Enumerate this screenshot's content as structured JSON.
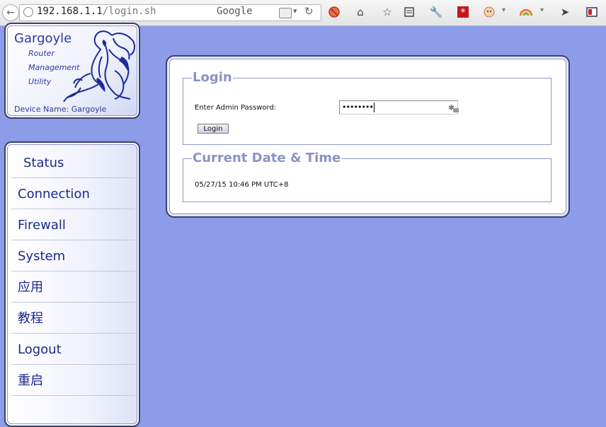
{
  "browser": {
    "url_host": "192.168.1.1",
    "url_path": "/login.sh",
    "search_engine": "Google",
    "toolbar_icons": [
      "adblock-icon",
      "home-icon",
      "bookmark-star-icon",
      "reader-icon",
      "wrench-icon",
      "addon-asterisk-icon",
      "face-addon-icon",
      "rainbow-addon-icon",
      "share-icon",
      "window-flag-icon"
    ]
  },
  "logo": {
    "title": "Gargoyle",
    "sub1": "Router",
    "sub2": "Management",
    "sub3": "Utility",
    "device_name": "Device Name: Gargoyle"
  },
  "nav": {
    "items": [
      {
        "label": "Status"
      },
      {
        "label": "Connection"
      },
      {
        "label": "Firewall"
      },
      {
        "label": "System"
      },
      {
        "label": "应用"
      },
      {
        "label": "教程"
      },
      {
        "label": "Logout"
      },
      {
        "label": "重启"
      }
    ]
  },
  "login": {
    "legend": "Login",
    "password_label": "Enter Admin Password:",
    "password_value": "••••••••",
    "button_label": "Login"
  },
  "datetime": {
    "legend": "Current Date & Time",
    "value": "05/27/15 10:46 PM UTC+8"
  },
  "colors": {
    "background": "#8d9ce8",
    "brand_blue": "#2a3a9e",
    "legend_color": "#8a93c5"
  }
}
